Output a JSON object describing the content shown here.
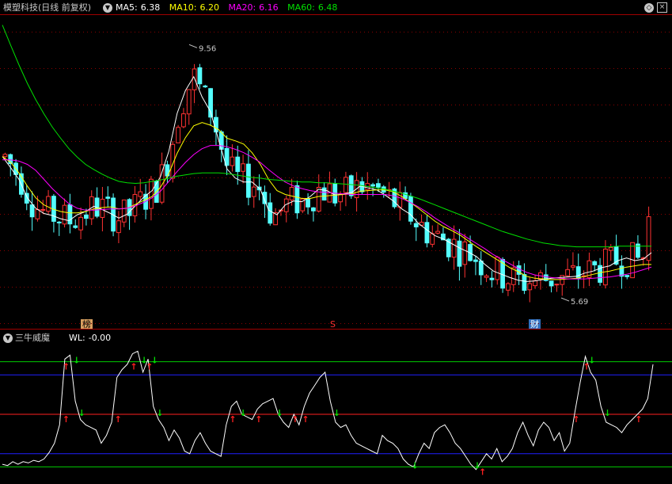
{
  "header": {
    "stock_name": "模塑科技",
    "mode": "(日线 前复权)",
    "ma": [
      {
        "label": "MA5:",
        "value": "6.38",
        "color": "#ffffff"
      },
      {
        "label": "MA10:",
        "value": "6.20",
        "color": "#ffff00"
      },
      {
        "label": "MA20:",
        "value": "6.16",
        "color": "#ff00ff"
      },
      {
        "label": "MA60:",
        "value": "6.48",
        "color": "#00e000"
      }
    ]
  },
  "indicator": {
    "name": "三牛威魔",
    "wl_label": "WL:",
    "wl_value": "-0.00"
  },
  "markers": {
    "high_label": "9.56",
    "low_label": "5.69",
    "tag_bang": "榜",
    "tag_s": "S",
    "tag_cai": "财"
  },
  "colors": {
    "up": "#ff3232",
    "down": "#54ffff",
    "ma5": "#ffffff",
    "ma10": "#ffff00",
    "ma20": "#ff00ff",
    "ma60": "#00e000",
    "grid": "#8b0000",
    "panel_border": "#a00000"
  },
  "chart_data": [
    {
      "type": "candlestick",
      "title": "模塑科技 (日线 前复权)",
      "x_count": 120,
      "annotated_high": 9.56,
      "annotated_low": 5.69,
      "ylim": [
        5.4,
        10.0
      ],
      "series": [
        {
          "name": "MA5",
          "values": [
            7.85,
            7.68,
            7.5,
            7.22,
            7.06,
            6.98,
            6.95,
            6.9,
            6.87,
            6.96,
            7.01,
            7.09,
            7.04,
            6.98,
            6.91,
            6.97,
            7.1,
            7.23,
            7.33,
            7.54,
            7.93,
            8.51,
            8.86,
            9.07,
            8.76,
            8.54,
            8.1,
            7.66,
            7.52,
            7.46,
            7.46,
            7.35,
            7.03,
            6.96,
            7.11,
            7.17,
            7.16,
            7.24,
            7.35,
            7.33,
            7.26,
            7.28,
            7.3,
            7.4,
            7.37,
            7.34,
            7.26,
            7.17,
            7.05,
            6.97,
            6.83,
            6.73,
            6.64,
            6.59,
            6.52,
            6.45,
            6.39,
            6.32,
            6.2,
            6.1,
            6.05,
            6.0,
            5.96,
            5.94,
            5.95,
            5.97,
            5.99,
            6.0,
            6.01,
            6.02,
            6.07,
            6.1,
            6.15,
            6.18,
            6.26,
            6.3,
            6.26,
            6.28,
            6.38
          ]
        },
        {
          "name": "MA10",
          "values": [
            7.85,
            7.76,
            7.6,
            7.4,
            7.22,
            7.11,
            7.05,
            7.01,
            6.99,
            6.99,
            7.01,
            7.05,
            7.07,
            7.08,
            7.05,
            7.06,
            7.12,
            7.18,
            7.24,
            7.38,
            7.59,
            7.9,
            8.14,
            8.32,
            8.37,
            8.33,
            8.26,
            8.13,
            8.09,
            8.04,
            7.91,
            7.73,
            7.5,
            7.33,
            7.27,
            7.24,
            7.21,
            7.21,
            7.24,
            7.25,
            7.26,
            7.27,
            7.28,
            7.32,
            7.33,
            7.34,
            7.34,
            7.31,
            7.24,
            7.15,
            7.06,
            6.96,
            6.86,
            6.78,
            6.72,
            6.65,
            6.56,
            6.47,
            6.39,
            6.31,
            6.23,
            6.15,
            6.09,
            6.02,
            5.99,
            5.98,
            5.97,
            5.97,
            5.98,
            5.99,
            6.02,
            6.05,
            6.08,
            6.1,
            6.13,
            6.16,
            6.18,
            6.2,
            6.2
          ]
        },
        {
          "name": "MA20",
          "values": [
            7.8,
            7.8,
            7.78,
            7.73,
            7.64,
            7.5,
            7.36,
            7.24,
            7.13,
            7.06,
            7.03,
            7.03,
            7.04,
            7.05,
            7.05,
            7.06,
            7.1,
            7.15,
            7.22,
            7.32,
            7.47,
            7.62,
            7.76,
            7.88,
            7.97,
            8.02,
            8.02,
            8.0,
            7.96,
            7.91,
            7.84,
            7.76,
            7.65,
            7.55,
            7.46,
            7.4,
            7.36,
            7.33,
            7.31,
            7.3,
            7.29,
            7.28,
            7.27,
            7.27,
            7.27,
            7.27,
            7.27,
            7.25,
            7.21,
            7.15,
            7.08,
            7.0,
            6.91,
            6.83,
            6.75,
            6.68,
            6.6,
            6.52,
            6.44,
            6.35,
            6.28,
            6.21,
            6.14,
            6.08,
            6.04,
            6.02,
            6.0,
            5.99,
            5.98,
            5.98,
            5.98,
            5.99,
            6.0,
            6.01,
            6.03,
            6.05,
            6.08,
            6.12,
            6.16
          ]
        },
        {
          "name": "MA60",
          "values": [
            9.86,
            9.55,
            9.25,
            8.97,
            8.72,
            8.5,
            8.3,
            8.13,
            7.97,
            7.84,
            7.73,
            7.65,
            7.58,
            7.52,
            7.47,
            7.45,
            7.44,
            7.45,
            7.47,
            7.49,
            7.52,
            7.55,
            7.57,
            7.59,
            7.6,
            7.6,
            7.6,
            7.59,
            7.57,
            7.55,
            7.53,
            7.52,
            7.5,
            7.49,
            7.48,
            7.47,
            7.46,
            7.46,
            7.45,
            7.45,
            7.44,
            7.43,
            7.42,
            7.41,
            7.39,
            7.37,
            7.35,
            7.32,
            7.29,
            7.25,
            7.21,
            7.16,
            7.11,
            7.06,
            7.01,
            6.96,
            6.91,
            6.86,
            6.81,
            6.76,
            6.71,
            6.67,
            6.63,
            6.59,
            6.56,
            6.53,
            6.51,
            6.49,
            6.48,
            6.47,
            6.47,
            6.47,
            6.47,
            6.47,
            6.48,
            6.48,
            6.48,
            6.48,
            6.48
          ]
        }
      ]
    },
    {
      "type": "line",
      "title": "三牛威魔",
      "series": [
        {
          "name": "WL",
          "values": [
            12,
            11,
            14,
            12,
            14,
            13,
            15,
            14,
            16,
            21,
            28,
            42,
            92,
            95,
            60,
            46,
            42,
            40,
            38,
            28,
            34,
            44,
            78,
            84,
            88,
            96,
            98,
            82,
            92,
            56,
            46,
            40,
            30,
            38,
            32,
            22,
            20,
            30,
            36,
            28,
            22,
            20,
            18,
            42,
            56,
            60,
            50,
            48,
            46,
            54,
            58,
            60,
            62,
            50,
            44,
            40,
            50,
            42,
            56,
            66,
            72,
            78,
            82,
            60,
            44,
            40,
            42,
            34,
            28,
            26,
            24,
            22,
            20,
            34,
            30,
            28,
            24,
            16,
            12,
            10,
            20,
            28,
            24,
            36,
            40,
            42,
            36,
            28,
            24,
            18,
            12,
            8,
            14,
            20,
            16,
            24,
            14,
            18,
            24,
            36,
            44,
            34,
            26,
            38,
            44,
            40,
            30,
            36,
            22,
            28,
            52,
            74,
            94,
            82,
            76,
            56,
            44,
            42,
            40,
            36,
            42,
            46,
            50,
            54,
            62,
            88
          ]
        }
      ]
    }
  ]
}
